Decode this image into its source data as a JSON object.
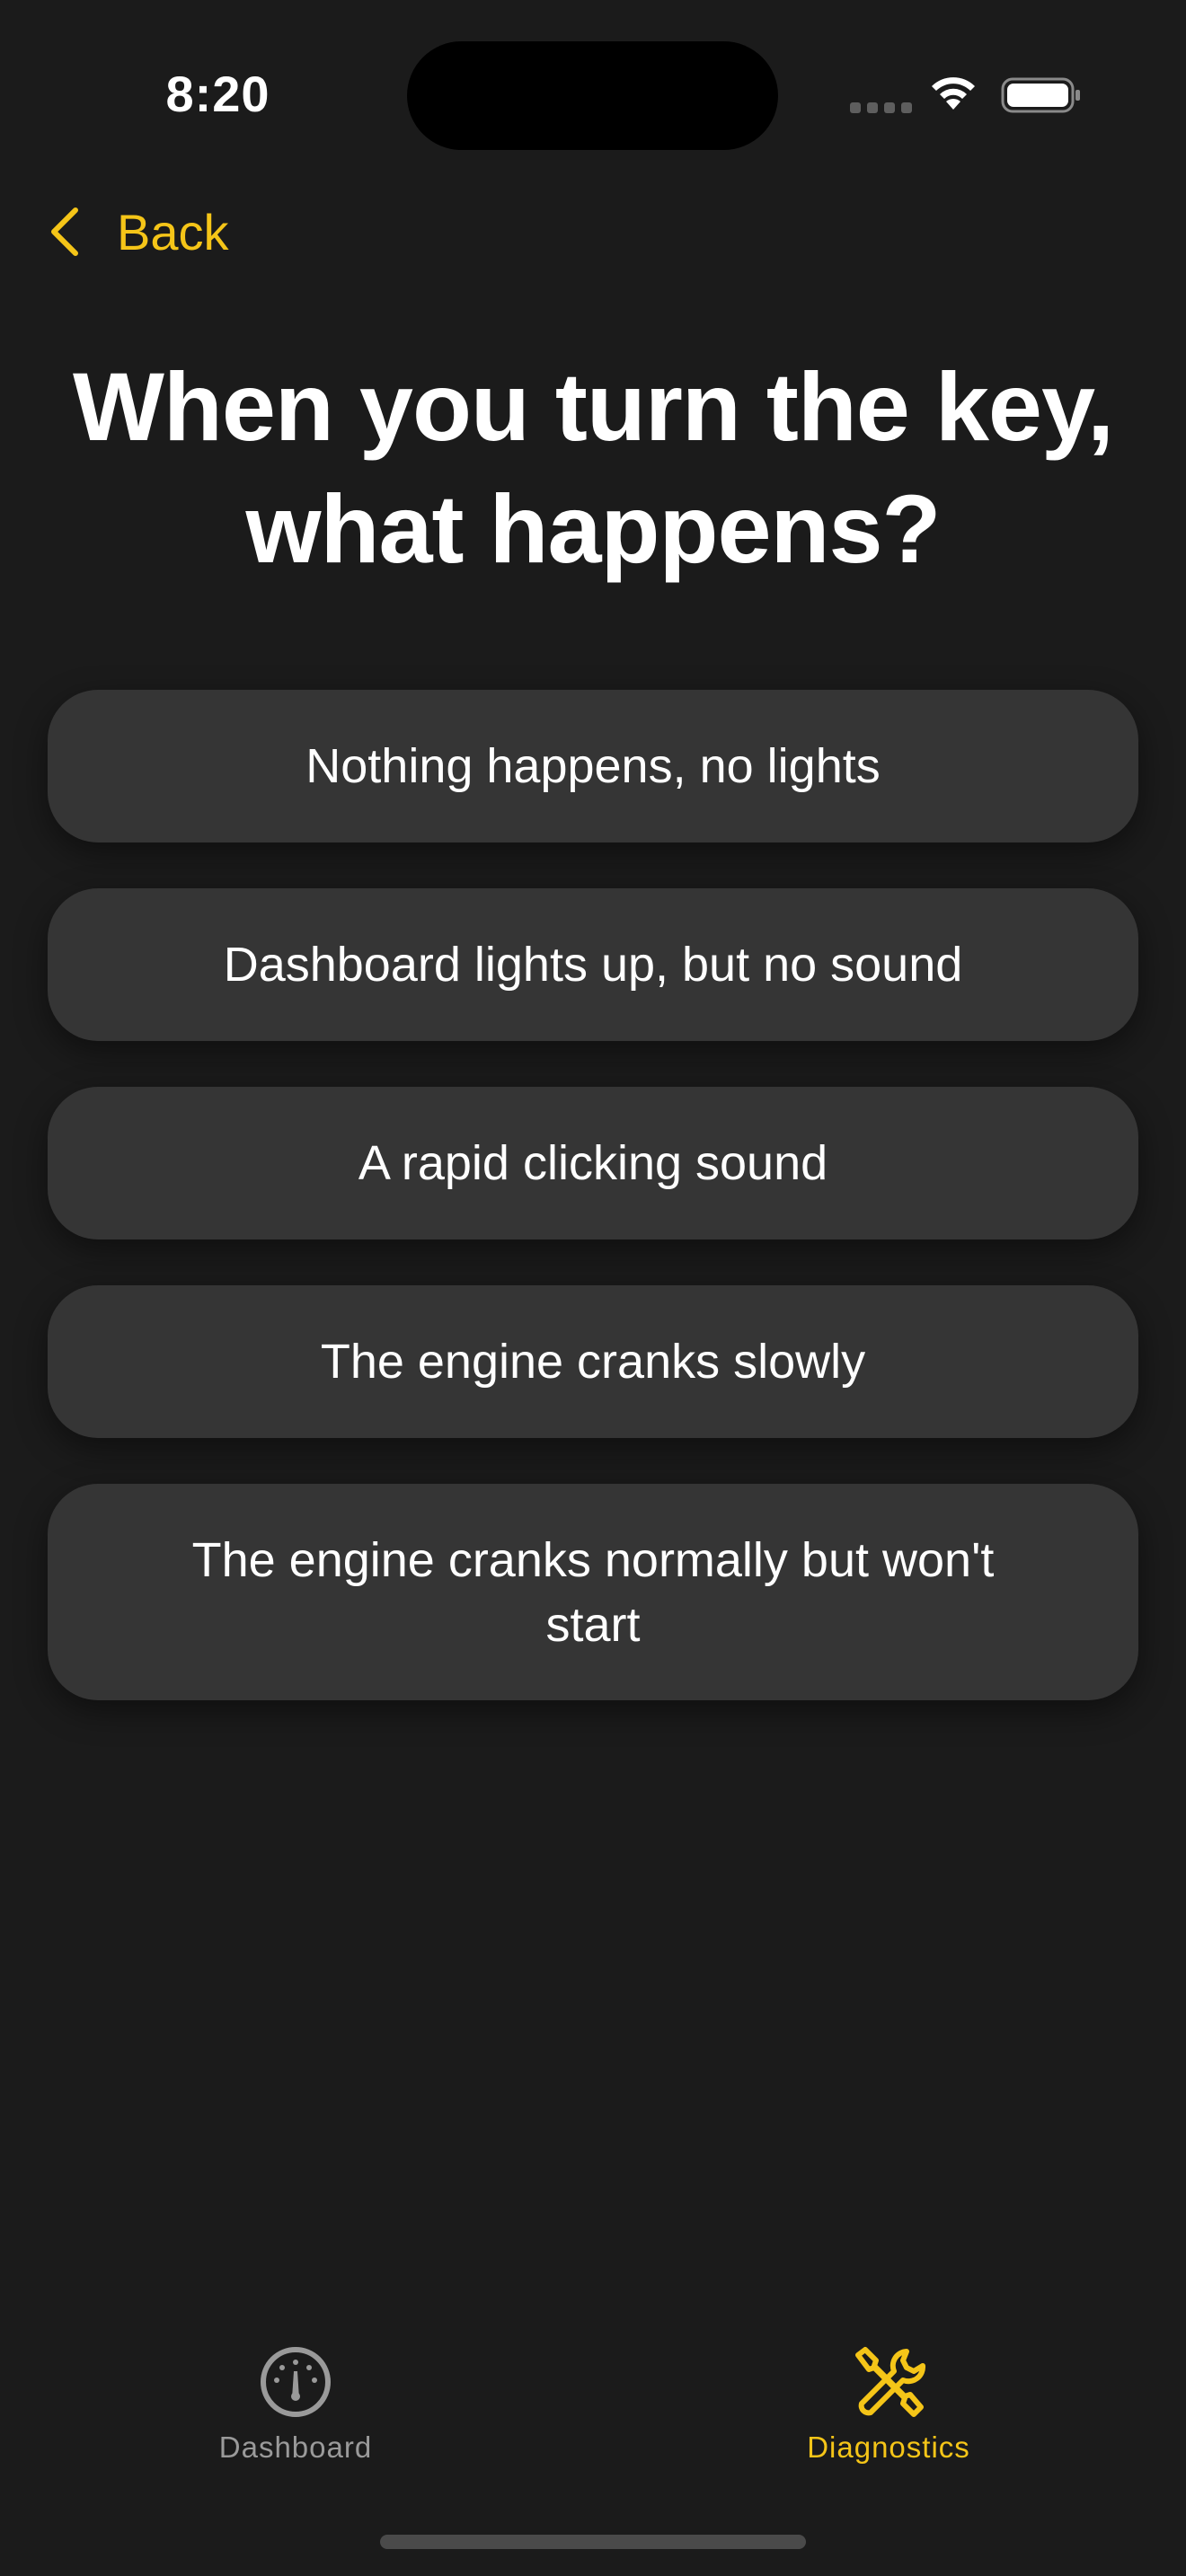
{
  "status_bar": {
    "time": "8:20",
    "icons": [
      "cellular-dots-icon",
      "wifi-icon",
      "battery-icon"
    ]
  },
  "nav": {
    "back_label": "Back",
    "back_icon": "chevron-left-icon"
  },
  "question": {
    "title": "When you turn the key, what happens?"
  },
  "answers": [
    {
      "label": "Nothing happens, no lights"
    },
    {
      "label": "Dashboard lights up, but no sound"
    },
    {
      "label": "A rapid clicking sound"
    },
    {
      "label": "The engine cranks slowly"
    },
    {
      "label": "The engine cranks normally but won't start"
    }
  ],
  "tab_bar": {
    "tabs": [
      {
        "label": "Dashboard",
        "icon": "speedometer-icon",
        "selected": false
      },
      {
        "label": "Diagnostics",
        "icon": "wrench-screwdriver-icon",
        "selected": true
      }
    ]
  },
  "colors": {
    "background": "#1b1b1b",
    "card": "#353535",
    "accent": "#f5c518",
    "inactive": "#9a9a9a"
  }
}
